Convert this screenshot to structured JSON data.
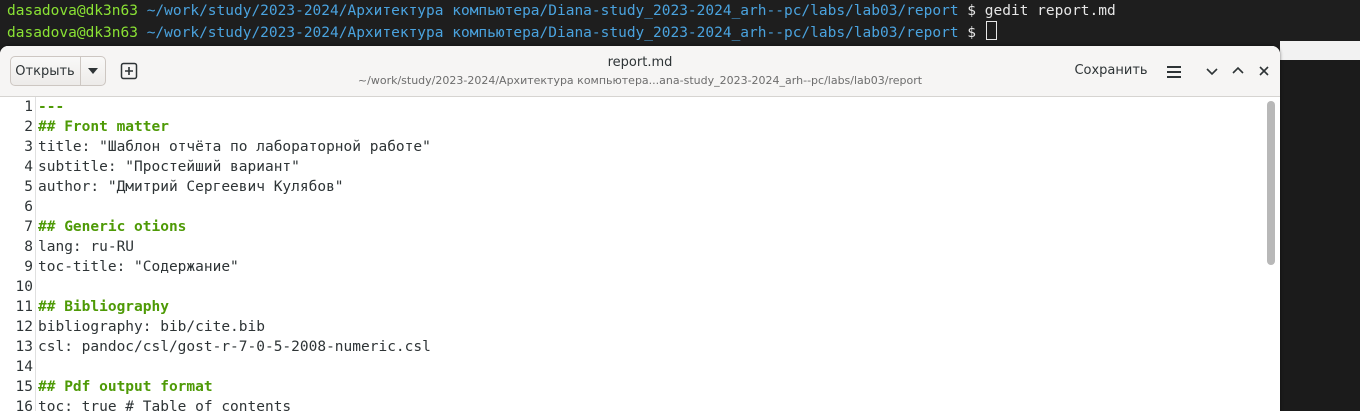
{
  "terminal": {
    "lines": [
      {
        "user": "dasadova@dk3n63",
        "path": "~/work/study/2023-2024/Архитектура компьютера/Diana-study_2023-2024_arh--pc/labs/lab03/report",
        "prompt": "$",
        "command": "gedit report.md"
      },
      {
        "user": "dasadova@dk3n63",
        "path": "~/work/study/2023-2024/Архитектура компьютера/Diana-study_2023-2024_arh--pc/labs/lab03/report",
        "prompt": "$",
        "command": ""
      }
    ]
  },
  "gedit": {
    "open_label": "Открыть",
    "title": "report.md",
    "subtitle": "~/work/study/2023-2024/Архитектура компьютера...ana-study_2023-2024_arh--pc/labs/lab03/report",
    "save_label": "Сохранить",
    "icons": [
      "chevron-down-icon",
      "new-tab-icon",
      "hamburger-menu-icon",
      "minimize-icon",
      "maximize-icon",
      "close-icon"
    ]
  },
  "editor": {
    "lines": [
      {
        "num": "1",
        "text": "---"
      },
      {
        "num": "2",
        "text": "## Front matter"
      },
      {
        "num": "3",
        "text": "title: \"Шаблон отчёта по лабораторной работе\""
      },
      {
        "num": "4",
        "text": "subtitle: \"Простейший вариант\""
      },
      {
        "num": "5",
        "text": "author: \"Дмитрий Сергеевич Кулябов\""
      },
      {
        "num": "6",
        "text": ""
      },
      {
        "num": "7",
        "text": "## Generic otions"
      },
      {
        "num": "8",
        "text": "lang: ru-RU"
      },
      {
        "num": "9",
        "text": "toc-title: \"Содержание\""
      },
      {
        "num": "10",
        "text": ""
      },
      {
        "num": "11",
        "text": "## Bibliography"
      },
      {
        "num": "12",
        "text": "bibliography: bib/cite.bib"
      },
      {
        "num": "13",
        "text": "csl: pandoc/csl/gost-r-7-0-5-2008-numeric.csl"
      },
      {
        "num": "14",
        "text": ""
      },
      {
        "num": "15",
        "text": "## Pdf output format"
      },
      {
        "num": "16",
        "text": "toc: true # Table of contents"
      }
    ],
    "heading_color": "#4e9a06",
    "scroll_position": 0
  }
}
